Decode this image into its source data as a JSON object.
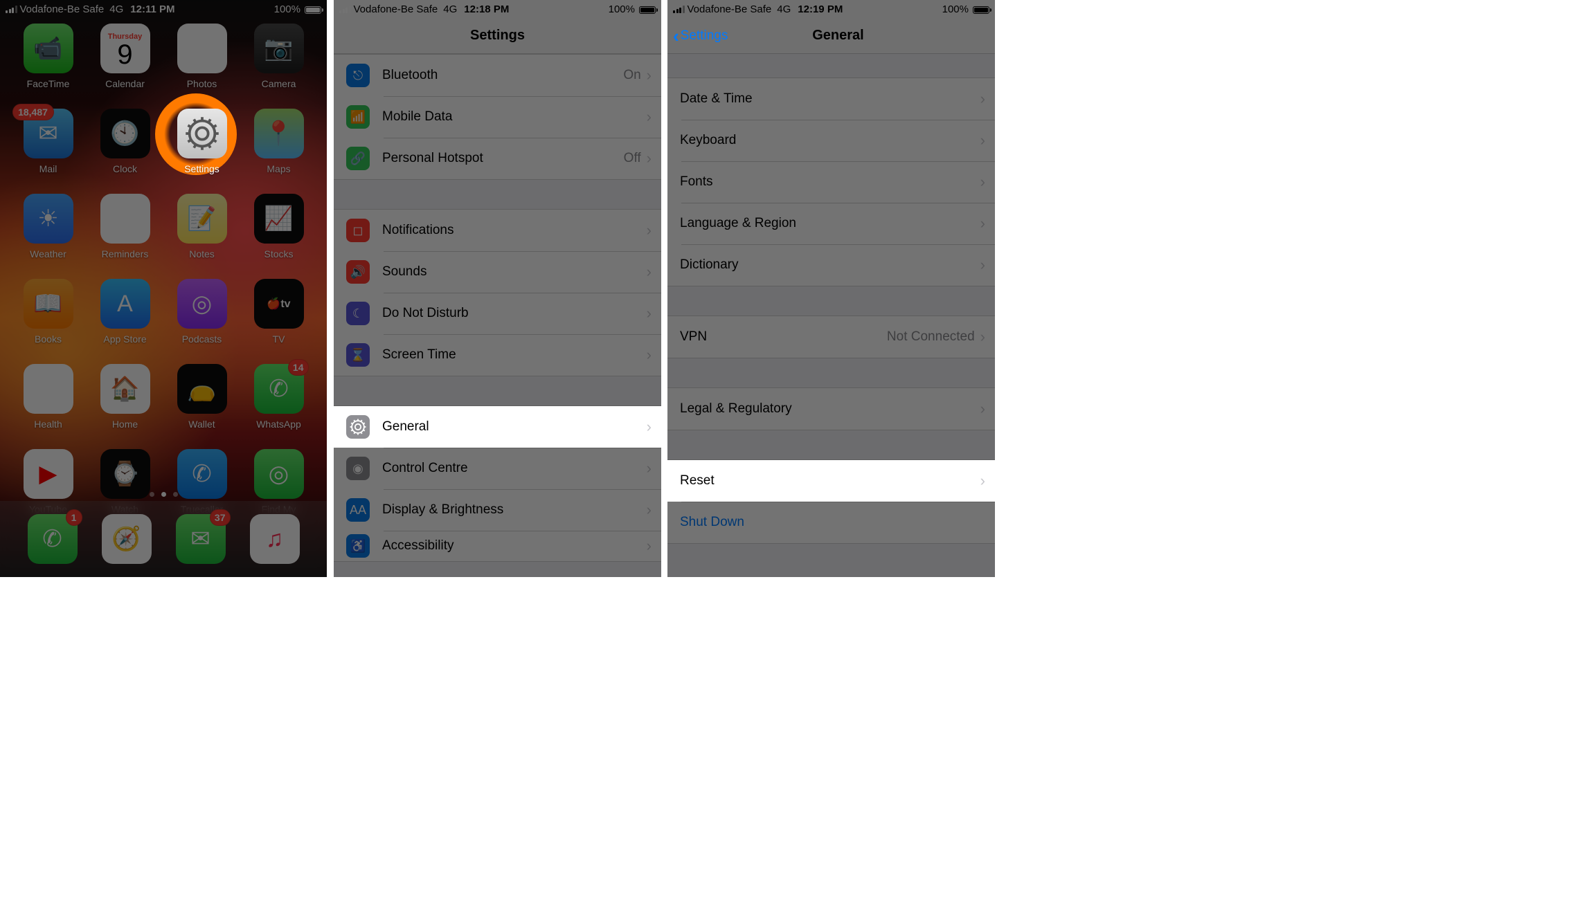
{
  "screen1": {
    "status": {
      "carrier": "Vodafone-Be Safe",
      "network": "4G",
      "time": "12:11 PM",
      "battery": "100%"
    },
    "apps": {
      "row1": [
        {
          "name": "FaceTime",
          "bg": "linear-gradient(#6fe86f,#1dbd1d)",
          "glyph": "📹"
        },
        {
          "name": "Calendar",
          "bg": "#fff",
          "sub": "Thursday",
          "day": "9"
        },
        {
          "name": "Photos",
          "bg": "#fff",
          "glyph": "✿"
        },
        {
          "name": "Camera",
          "bg": "linear-gradient(#4a4a4a,#1e1e1e)",
          "glyph": "📷"
        }
      ],
      "row2": [
        {
          "name": "Mail",
          "bg": "linear-gradient(#5ac8fa,#1e76d9)",
          "glyph": "✉",
          "badge": "18,487",
          "badgeWide": true
        },
        {
          "name": "Clock",
          "bg": "#0c0c0c",
          "glyph": "🕙"
        },
        {
          "name": "Settings",
          "bg": "linear-gradient(#e6e6e6,#bfbfbf)",
          "gear": true,
          "highlight": true
        },
        {
          "name": "Maps",
          "bg": "linear-gradient(#a8e06f,#5cc1ff)",
          "glyph": "📍"
        }
      ],
      "row3": [
        {
          "name": "Weather",
          "bg": "linear-gradient(#4aa8ff,#2e6ff0)",
          "glyph": "☀"
        },
        {
          "name": "Reminders",
          "bg": "#fff",
          "glyph": "≣"
        },
        {
          "name": "Notes",
          "bg": "linear-gradient(#fff4a6,#ffe35a)",
          "glyph": "📝"
        },
        {
          "name": "Stocks",
          "bg": "#0c0c0c",
          "glyph": "📈"
        }
      ],
      "row4": [
        {
          "name": "Books",
          "bg": "linear-gradient(#ffa834,#ff7a00)",
          "glyph": "📖"
        },
        {
          "name": "App Store",
          "bg": "linear-gradient(#39c5ff,#1d71f2)",
          "glyph": "A"
        },
        {
          "name": "Podcasts",
          "bg": "linear-gradient(#c462ff,#8b2cf5)",
          "glyph": "◎"
        },
        {
          "name": "TV",
          "bg": "#0c0c0c",
          "svg": "tv",
          "glyph": "tv"
        }
      ],
      "row5": [
        {
          "name": "Health",
          "bg": "#fff",
          "glyph": "♥"
        },
        {
          "name": "Home",
          "bg": "#fff",
          "glyph": "🏠"
        },
        {
          "name": "Wallet",
          "bg": "#0c0c0c",
          "glyph": "👝"
        },
        {
          "name": "WhatsApp",
          "bg": "linear-gradient(#60f06a,#1bbf3a)",
          "glyph": "✆",
          "badge": "14"
        }
      ],
      "row6": [
        {
          "name": "YouTube",
          "bg": "#fff",
          "glyph": "▶",
          "glyphColor": "#ff0000"
        },
        {
          "name": "Watch",
          "bg": "#0c0c0c",
          "glyph": "⌚"
        },
        {
          "name": "Truecaller",
          "bg": "linear-gradient(#38b3ff,#0a7be6)",
          "glyph": "✆"
        },
        {
          "name": "Find My",
          "bg": "linear-gradient(#64e86b,#1dbb3a)",
          "glyph": "◎"
        }
      ]
    },
    "dock": [
      {
        "name": "Phone",
        "bg": "linear-gradient(#6be86b,#1dbb3a)",
        "glyph": "✆",
        "badge": "1"
      },
      {
        "name": "Safari",
        "bg": "#fff",
        "glyph": "🧭"
      },
      {
        "name": "Messages",
        "bg": "linear-gradient(#6be86b,#1dbb3a)",
        "glyph": "✉",
        "badge": "37"
      },
      {
        "name": "Music",
        "bg": "#fff",
        "glyph": "♫",
        "glyphColor": "#ff2d55"
      }
    ]
  },
  "screen2": {
    "status": {
      "carrier": "Vodafone-Be Safe",
      "network": "4G",
      "time": "12:18 PM",
      "battery": "100%"
    },
    "title": "Settings",
    "section1": [
      {
        "label": "Bluetooth",
        "value": "On",
        "color": "#0a7be6",
        "glyph": "⎋"
      },
      {
        "label": "Mobile Data",
        "value": "",
        "color": "#34c759",
        "glyph": "📶"
      },
      {
        "label": "Personal Hotspot",
        "value": "Off",
        "color": "#34c759",
        "glyph": "🔗"
      }
    ],
    "section2": [
      {
        "label": "Notifications",
        "color": "#ff3b30",
        "glyph": "◻"
      },
      {
        "label": "Sounds",
        "color": "#ff3b30",
        "glyph": "🔊"
      },
      {
        "label": "Do Not Disturb",
        "color": "#5856d6",
        "glyph": "☾"
      },
      {
        "label": "Screen Time",
        "color": "#5856d6",
        "glyph": "⌛"
      }
    ],
    "section3": [
      {
        "label": "General",
        "color": "#8e8e93",
        "gear": true,
        "highlight": true
      },
      {
        "label": "Control Centre",
        "color": "#8e8e93",
        "glyph": "◉"
      },
      {
        "label": "Display & Brightness",
        "color": "#0a7be6",
        "glyph": "AA"
      },
      {
        "label": "Accessibility",
        "color": "#0a7be6",
        "glyph": "♿"
      }
    ]
  },
  "screen3": {
    "status": {
      "carrier": "Vodafone-Be Safe",
      "network": "4G",
      "time": "12:19 PM",
      "battery": "100%"
    },
    "back": "Settings",
    "title": "General",
    "section1": [
      {
        "label": "Date & Time"
      },
      {
        "label": "Keyboard"
      },
      {
        "label": "Fonts"
      },
      {
        "label": "Language & Region"
      },
      {
        "label": "Dictionary"
      }
    ],
    "section2": [
      {
        "label": "VPN",
        "value": "Not Connected"
      }
    ],
    "section3": [
      {
        "label": "Legal & Regulatory"
      }
    ],
    "section4": [
      {
        "label": "Reset",
        "highlight": true
      },
      {
        "label": "Shut Down",
        "blue": true
      }
    ]
  }
}
